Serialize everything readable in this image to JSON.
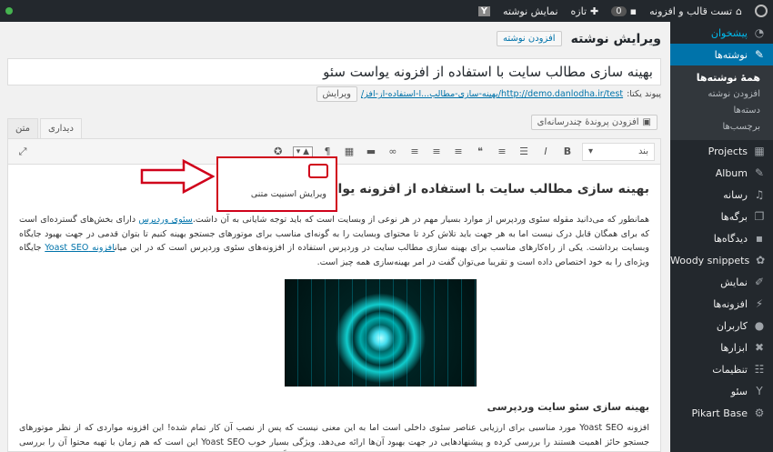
{
  "adminbar": {
    "site_name": "تست قالب و افزونه",
    "comments": "0",
    "new_label": "تازه",
    "view_post": "نمایش نوشته",
    "yoast": "Y"
  },
  "sidebar": {
    "suggest": "پیشخوان",
    "posts": "نوشته‌ها",
    "sub": [
      "همهٔ نوشته‌ها",
      "افزودن نوشته",
      "دسته‌ها",
      "برچسب‌ها"
    ],
    "items": [
      "Projects",
      "Album",
      "رسانه",
      "برگه‌ها",
      "دیدگاه‌ها",
      "Woody snippets",
      "نمایش",
      "افزونه‌ها",
      "کاربران",
      "ابزارها",
      "تنظیمات",
      "سئو",
      "Pikart Base"
    ]
  },
  "page": {
    "title": "ویرایش نوشته",
    "add_new": "افزودن نوشته",
    "post_title": "بهینه سازی مطالب سایت با استفاده از افزونه یواست سئو",
    "permalink_label": "پیوند یکتا:",
    "permalink_base": "http://demo.danlodha.ir/test/",
    "permalink_slug": "بهینه-سازی-مطالب...ا-استفاده-از-افز/",
    "edit_btn": "ویرایش",
    "add_media": "افزودن پروندهٔ چندرسانه‌ای"
  },
  "editor": {
    "tab_visual": "دیداری",
    "tab_text": "متن",
    "format_select": "بند",
    "menu_option": "ویرایش اسنیپت متنی",
    "heading": "بهینه سازی مطالب سایت با استفاده از افزونه یواست سئو",
    "p1_a": "همانطور که می‌دانید مقوله سئوی وردپرس از موارد بسیار مهم در هر نوعی از وبسایت است که باید توجه شایانی به آن داشت.",
    "p1_link": "سئوی وردپرس",
    "p1_b": " دارای بخش‌های گسترده‌ای است که برای همگان قابل درک نیست اما به هر جهت باید تلاش کرد تا محتوای وبسایت را به گونه‌ای مناسب برای موتورهای جستجو بهینه کنیم تا بتوان قدمی در جهت بهبود جایگاه وبسایت برداشت. یکی از راه‌کارهای مناسب برای بهینه سازی مطالب سایت در وردپرس استفاده از افزونه‌های سئوی وردپرس است که در این میان",
    "p1_link2": "افزونه Yoast SEO",
    "p1_c": " جایگاه ویژه‌ای را به خود اختصاص داده است و تقریبا می‌توان گفت در امر بهینه‌سازی همه چیز است.",
    "h3": "بهینه سازی سئو سایت وردپرسی",
    "p2": "افزونه Yoast SEO مورد مناسبی برای ارزیابی عناصر سئوی داخلی است اما به این معنی نیست که پس از نصب آن کار تمام شده! این افزونه مواردی که از نظر موتورهای جستجو حائز اهمیت هستند را بررسی کرده و پیشنهادهایی در جهت بهبود آن‌ها ارائه می‌دهد. ویژگی بسیار خوب Yoast SEO این است که هم زمان با تهیه محتوا آن را بررسی می‌کند و در انتهای مقاله بخشی برای بهبود ارائه می‌دهد که نسبت به تغییرات محتوا واکنش داده و کاملاً پویا است."
  },
  "colors": {
    "accent": "#0073aa",
    "annotation": "#d0021b",
    "sidebar": "#23282d"
  }
}
